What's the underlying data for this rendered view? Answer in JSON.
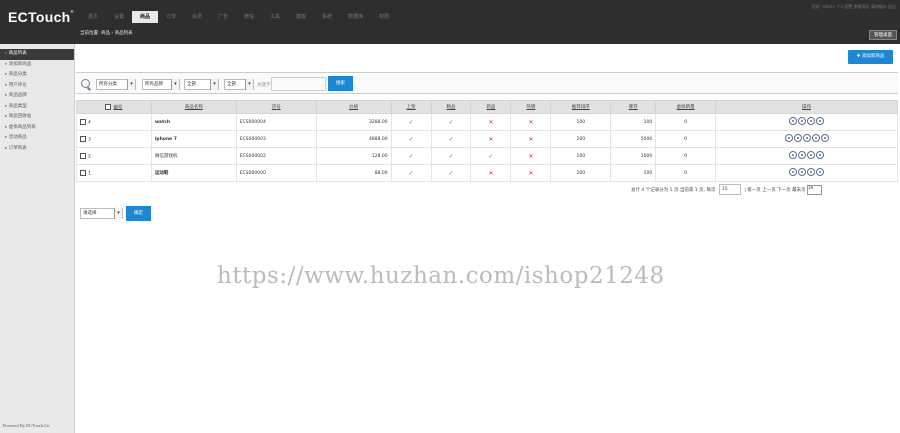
{
  "logo": "ECTouch",
  "nav": [
    "首页",
    "设置",
    "商品",
    "订单",
    "会员",
    "广告",
    "微信",
    "工具",
    "模板",
    "系统",
    "数据库",
    "权限"
  ],
  "nav_active": 2,
  "topright": "您好: admin  个人设置  查看网店  清除缓存  退出",
  "breadcrumb": "当前位置: 商品 › 商品列表",
  "manage_button": "管理桌面",
  "sidebar": [
    "商品列表",
    "添加新商品",
    "商品分类",
    "用户评论",
    "商品品牌",
    "商品类型",
    "商品回收站",
    "虚拟商品列表",
    "活动商品",
    "订单列表"
  ],
  "sidebar_active": 0,
  "powered": "Powered By ECTouch.Cn",
  "add_button": "添加新商品",
  "filter": {
    "category": "所有分类",
    "brand": "所有品牌",
    "type": "全部",
    "status": "全部",
    "keyword_label": "关键字",
    "search_button": "搜索"
  },
  "table": {
    "headers": [
      "编号",
      "商品名称",
      "货号",
      "价格",
      "上架",
      "精品",
      "新品",
      "热销",
      "推荐排序",
      "库存",
      "虚拟销量",
      "操作"
    ],
    "rows": [
      {
        "id": "4",
        "name": "watch",
        "sn": "ECS000004",
        "price": "3288.00",
        "onsale": true,
        "best": true,
        "new": false,
        "hot": false,
        "sort": "100",
        "stock": "100",
        "virtual": "0"
      },
      {
        "id": "3",
        "name": "iphone 7",
        "sn": "ECS000003",
        "price": "4888.00",
        "onsale": true,
        "best": true,
        "new": false,
        "hot": false,
        "sort": "100",
        "stock": "5000",
        "virtual": "0"
      },
      {
        "id": "2",
        "name": "微信游戏机",
        "sn": "ECS000002",
        "price": "128.00",
        "onsale": true,
        "best": true,
        "new": true,
        "hot": false,
        "sort": "100",
        "stock": "1000",
        "virtual": "0"
      },
      {
        "id": "1",
        "name": "运动鞋",
        "sn": "ECS000000",
        "price": "88.00",
        "onsale": true,
        "best": true,
        "new": false,
        "hot": false,
        "sort": "100",
        "stock": "100",
        "virtual": "0"
      }
    ]
  },
  "pager": {
    "summary": "总计 4 个记录分为 1 页 当前第 1 页, 每页",
    "per_page": "15",
    "links": "| 第一页 上一页 下一页 最末页",
    "page": "1"
  },
  "batch": {
    "select": "请选择",
    "confirm": "确定"
  },
  "watermark": "https://www.huzhan.com/ishop21248"
}
